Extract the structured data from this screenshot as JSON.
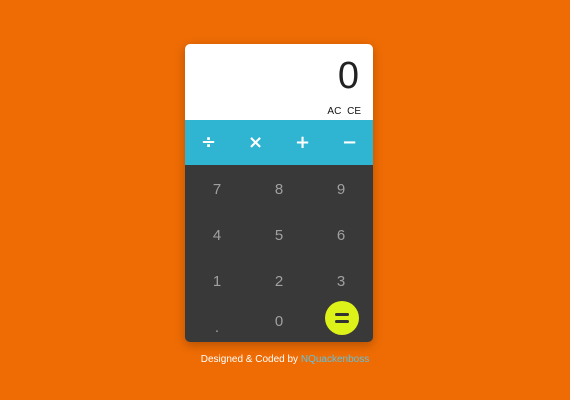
{
  "display": {
    "value": "0",
    "clear_all": "AC",
    "clear_entry": "CE"
  },
  "operators": [
    {
      "label": "÷",
      "name": "divide"
    },
    {
      "label": "×",
      "name": "multiply"
    },
    {
      "label": "+",
      "name": "add"
    },
    {
      "label": "−",
      "name": "subtract"
    }
  ],
  "keys": {
    "k7": "7",
    "k8": "8",
    "k9": "9",
    "k4": "4",
    "k5": "5",
    "k6": "6",
    "k1": "1",
    "k2": "2",
    "k3": "3",
    "dot": ".",
    "k0": "0"
  },
  "footer": {
    "text": "Designed & Coded by",
    "author": "NQuackenboss"
  },
  "colors": {
    "background": "#EF6C04",
    "operator_bar": "#2FB4D1",
    "keypad": "#393939",
    "equals": "#DDF219",
    "author_link": "#5FC3E0"
  },
  "icons": {
    "equals": "equals-icon"
  }
}
